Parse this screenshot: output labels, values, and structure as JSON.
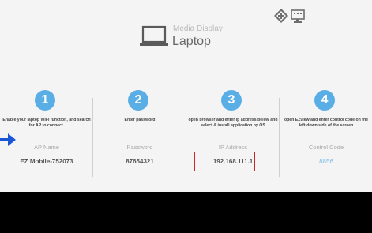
{
  "header": {
    "mode_subtitle": "Media Display",
    "mode_title": "Laptop",
    "icons": [
      "network-icon",
      "monitor-icon",
      "laptop-icon"
    ]
  },
  "steps": [
    {
      "number": "1",
      "description": "Enable your laptop WIFI function, and search for AP to connect.",
      "label": "AP Name",
      "value": "EZ Mobile-752073"
    },
    {
      "number": "2",
      "description": "Enter password",
      "label": "Password",
      "value": "87654321"
    },
    {
      "number": "3",
      "description": "open browser and enter ip address below and select & install application by OS",
      "label": "IP Address",
      "value": "192.168.111.1"
    },
    {
      "number": "4",
      "description": "open EZview and enter control code on the left-down side of the screen",
      "label": "Control Code",
      "value": "8856"
    }
  ],
  "colors": {
    "screen_background": "#f4f4f4",
    "step_circle": "#5aaee6",
    "highlight_box": "#c62828",
    "pointer_arrow": "#1a56d6",
    "control_code": "#7fbde6"
  }
}
